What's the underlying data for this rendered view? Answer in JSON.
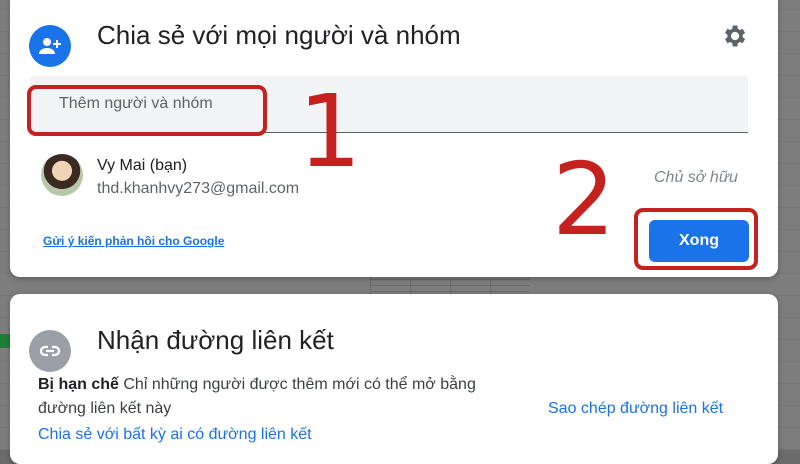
{
  "share_dialog": {
    "title": "Chia sẻ với mọi người và nhóm",
    "input_placeholder": "Thêm người và nhóm",
    "user": {
      "name": "Vy Mai (bạn)",
      "email": "thd.khanhvy273@gmail.com",
      "role": "Chủ sở hữu"
    },
    "feedback_link": "Gửi ý kiến phản hồi cho Google",
    "done_button": "Xong",
    "accent_color": "#1a73e8"
  },
  "link_dialog": {
    "title": "Nhận đường liên kết",
    "access_label": "Bị hạn chế",
    "access_description_1": "Chỉ những người được thêm mới có thể mở bằng",
    "access_description_2": "đường liên kết này",
    "share_anyone_link": "Chia sẻ với bất kỳ ai có đường liên kết",
    "copy_link": "Sao chép đường liên kết"
  },
  "annotations": {
    "step1": "1",
    "step2": "2",
    "highlight_color": "#c5221f"
  },
  "icons": {
    "share": "person-add-icon",
    "settings": "gear-icon",
    "link": "link-icon"
  }
}
